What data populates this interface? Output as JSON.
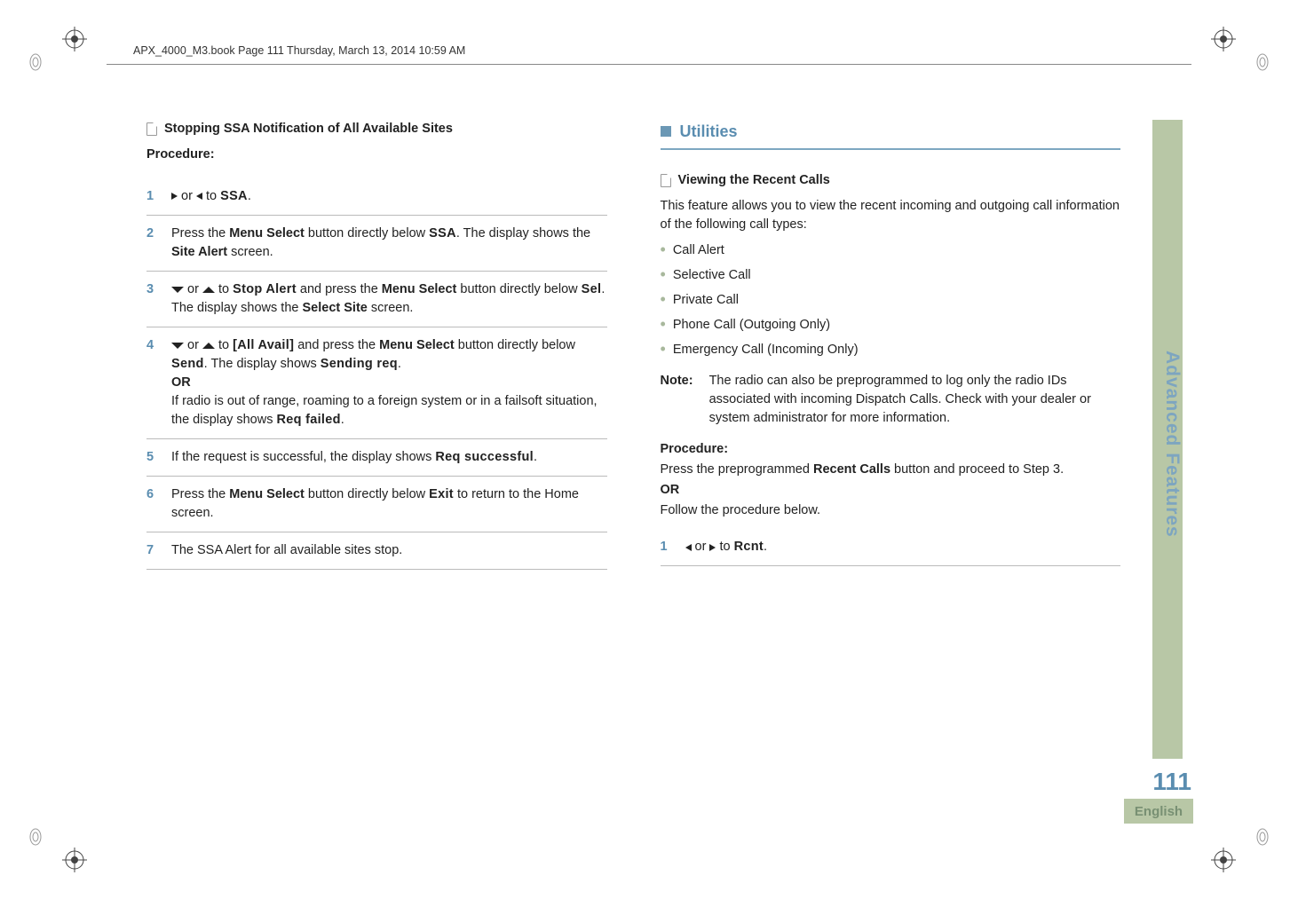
{
  "header": "APX_4000_M3.book  Page 111  Thursday, March 13, 2014  10:59 AM",
  "sideTab": {
    "title": "Advanced Features",
    "pageNum": "111",
    "english": "English"
  },
  "left": {
    "heading": "Stopping SSA Notification of All Available Sites",
    "procedureLabel": "Procedure:",
    "steps": {
      "s1": {
        "num": "1",
        "t1": " or ",
        "t2": " to ",
        "ssa": "SSA",
        "t3": "."
      },
      "s2": {
        "num": "2",
        "t1": "Press the ",
        "b1": "Menu Select",
        "t2": " button directly below ",
        "ssa": "SSA",
        "t3": ". The display shows the ",
        "b2": "Site Alert",
        "t4": " screen."
      },
      "s3": {
        "num": "3",
        "t1": " or ",
        "t2": "  to ",
        "m1": "Stop Alert",
        "t3": " and press the ",
        "b1": "Menu Select",
        "t4": " button directly below ",
        "m2": "Sel",
        "t5": ". The display shows the ",
        "b2": "Select Site",
        "t6": " screen."
      },
      "s4": {
        "num": "4",
        "t1": " or ",
        "t2": "  to ",
        "m1": "[All Avail]",
        "t3": " and press the ",
        "b1": "Menu Select",
        "t4": " button directly below ",
        "m2": "Send",
        "t5": ". The display shows ",
        "m3": "Sending req",
        "t6": ".",
        "or": "OR",
        "t7": "If radio is out of range, roaming to a foreign system or in a failsoft situation, the display shows ",
        "m4": "Req failed",
        "t8": "."
      },
      "s5": {
        "num": "5",
        "t1": "If the request is successful, the display shows ",
        "m1": "Req successful",
        "t2": "."
      },
      "s6": {
        "num": "6",
        "t1": "Press the ",
        "b1": "Menu Select",
        "t2": " button directly below ",
        "m1": "Exit",
        "t3": " to return to the Home screen."
      },
      "s7": {
        "num": "7",
        "t1": "The SSA Alert for all available sites stop."
      }
    }
  },
  "right": {
    "sectionTitle": "Utilities",
    "heading": "Viewing the Recent Calls",
    "intro": "This feature allows you to view the recent incoming and outgoing call information of the following call types:",
    "bullets": [
      "Call Alert",
      "Selective Call",
      "Private Call",
      "Phone Call (Outgoing Only)",
      "Emergency Call (Incoming Only)"
    ],
    "noteLabel": "Note:",
    "noteBody": "The radio can also be preprogrammed to log only the radio IDs associated with incoming Dispatch Calls. Check with your dealer or system administrator for more information.",
    "procedureLabel": "Procedure:",
    "procIntro1a": "Press the preprogrammed ",
    "procIntro1b": "Recent Calls",
    "procIntro1c": " button and proceed to Step 3.",
    "or": "OR",
    "procIntro2": "Follow the procedure below.",
    "steps": {
      "s1": {
        "num": "1",
        "t1": " or ",
        "t2": " to ",
        "m1": "Rcnt",
        "t3": "."
      }
    }
  }
}
